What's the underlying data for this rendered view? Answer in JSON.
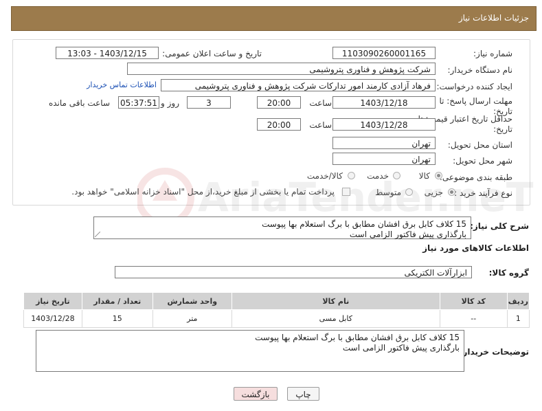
{
  "header": {
    "title": "جزئیات اطلاعات نیاز"
  },
  "form": {
    "need_number_label": "شماره نیاز:",
    "need_number": "1103090260001165",
    "announce_label": "تاریخ و ساعت اعلان عمومی:",
    "announce_value": "1403/12/15 - 13:03",
    "buyer_org_label": "نام دستگاه خریدار:",
    "buyer_org": "شرکت پژوهش و فناوری پتروشیمی",
    "creator_label": "ایجاد کننده درخواست:",
    "creator": "فرهاد آزادی کارمند امور تدارکات شرکت پژوهش و فناوری پتروشیمی",
    "contact_link": "اطلاعات تماس خریدار",
    "deadline_label_line1": "مهلت ارسال پاسخ: تا",
    "deadline_label_line2": "تاریخ:",
    "deadline_date": "1403/12/18",
    "time_label": "ساعت",
    "deadline_time": "20:00",
    "days_value": "3",
    "days_label": "روز و",
    "remaining_time": "05:37:51",
    "remaining_label": "ساعت باقی مانده",
    "price_validity_label_line1": "حداقل تاریخ اعتبار قیمت: تا",
    "price_validity_label_line2": "تاریخ:",
    "price_validity_date": "1403/12/28",
    "price_validity_time": "20:00",
    "province_label": "استان محل تحویل:",
    "province": "تهران",
    "city_label": "شهر محل تحویل:",
    "city": "تهران",
    "category_label": "طبقه بندی موضوعی:",
    "category_options": [
      "کالا",
      "خدمت",
      "کالا/خدمت"
    ],
    "category_selected": "کالا",
    "process_label": "نوع فرآیند خرید :",
    "process_options": [
      "جزیی",
      "متوسط"
    ],
    "process_selected": "جزیی",
    "payment_note": "پرداخت تمام یا بخشی از مبلغ خرید،از محل \"اسناد خزانه اسلامی\" خواهد بود."
  },
  "summary": {
    "label": "شرح کلی نیاز:",
    "text": "15 کلاف کابل برق افشان مطابق با برگ استعلام بها پیوست\nبارگذاری پیش فاکتور الزامی است"
  },
  "goods_section_title": "اطلاعات کالاهای مورد نیاز",
  "goods_group": {
    "label": "گروه کالا:",
    "value": "ابزارآلات الکتریکی"
  },
  "table": {
    "headers": [
      "ردیف",
      "کد کالا",
      "نام کالا",
      "واحد شمارش",
      "تعداد / مقدار",
      "تاریخ نیاز"
    ],
    "rows": [
      [
        "1",
        "--",
        "کابل مسی",
        "متر",
        "15",
        "1403/12/28"
      ]
    ]
  },
  "buyer_notes": {
    "label": "توضیحات خریدار:",
    "text": "15 کلاف کابل برق افشان مطابق با برگ استعلام بها پیوست\nبارگذاری پیش فاکتور الزامی است"
  },
  "buttons": {
    "print": "چاپ",
    "back": "بازگشت"
  },
  "watermark_text": "AriaTender.neT",
  "colors": {
    "header_bg": "#9c7b4c",
    "link": "#1a4fb4",
    "back_button_bg": "#f6dede"
  }
}
